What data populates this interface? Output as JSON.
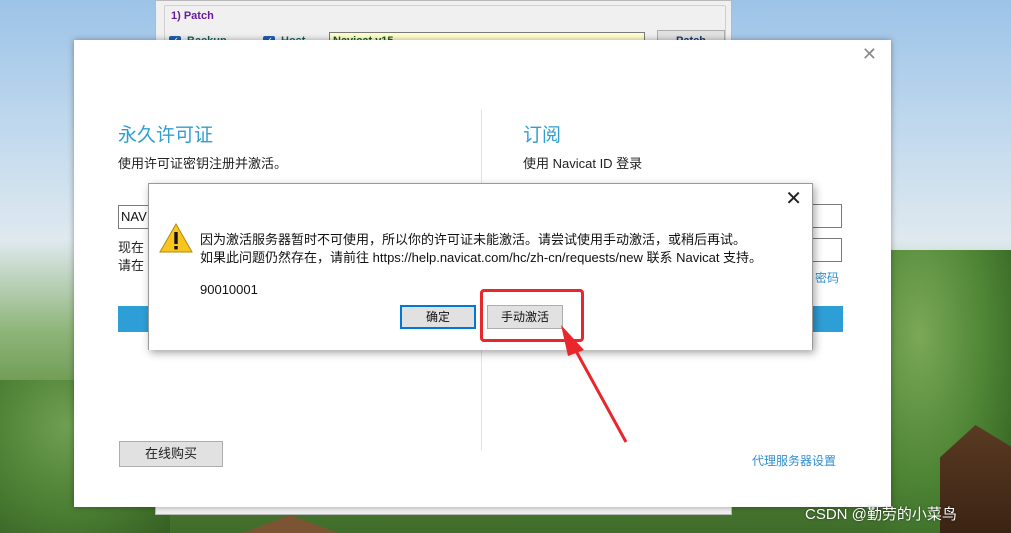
{
  "patcher": {
    "group_label": "1) Patch",
    "backup_label": "Backup",
    "host_label": "Host",
    "product_value": "Navicat v15",
    "patch_button": "Patch"
  },
  "registration": {
    "perpetual": {
      "title": "永久许可证",
      "subtitle": "使用许可证密钥注册并激活。",
      "key_value": "NAV",
      "note_line1": "现在",
      "note_line2": "请在"
    },
    "subscription": {
      "title": "订阅",
      "subtitle": "使用 Navicat ID 登录",
      "forgot_password_fragment": "密码"
    },
    "buy_online": "在线购买",
    "proxy_settings": "代理服务器设置"
  },
  "message_box": {
    "line1": "因为激活服务器暂时不可使用，所以你的许可证未能激活。请尝试使用手动激活，或稍后再试。",
    "line2": "如果此问题仍然存在，请前往 https://help.navicat.com/hc/zh-cn/requests/new 联系 Navicat 支持。",
    "code": "90010001",
    "ok_button": "确定",
    "manual_button": "手动激活"
  },
  "annotation_color": "#e8262c",
  "accent_color": "#2e9fd6",
  "watermark": "CSDN @勤劳的小菜鸟"
}
